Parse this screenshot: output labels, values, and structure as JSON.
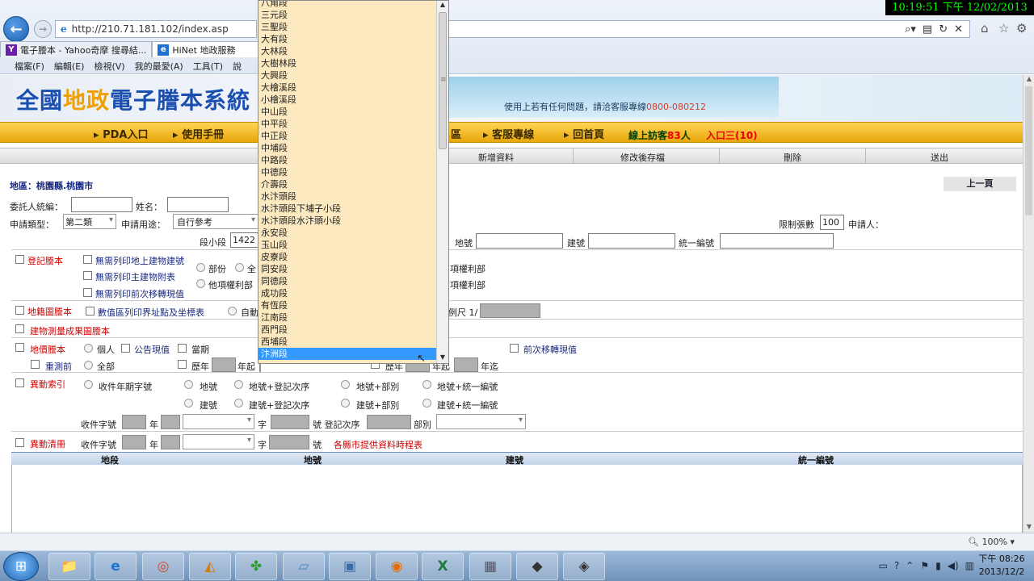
{
  "clock": "10:19:51 下午 12/02/2013",
  "browser": {
    "url_left": "http://210.71.181.102/index.asp",
    "addr_icons": [
      "search-icon",
      "compat-icon",
      "refresh-icon",
      "stop-icon"
    ],
    "tabs": [
      {
        "label": "電子謄本 - Yahoo奇摩 搜尋結...",
        "icon": "yahoo-icon",
        "color": "#6b1fa8"
      },
      {
        "label": "HiNet 地政服務",
        "icon": "ie-icon",
        "color": "#1e73d2"
      }
    ],
    "menu": [
      "檔案(F)",
      "編輯(E)",
      "檢視(V)",
      "我的最愛(A)",
      "工具(T)",
      "說"
    ]
  },
  "site": {
    "title_pre": "全國",
    "title_hl": "地政",
    "title_post": "電子謄本系統",
    "hotline_text": "使用上若有任何問題，請洽客服專線",
    "hotline_number": "0800-080212",
    "nav": [
      "PDA入口",
      "使用手冊",
      "區",
      "客服專線",
      "回首頁"
    ],
    "visitors_label": "線上訪客",
    "visitors_count": "83",
    "visitors_unit": "人",
    "entry": "入口三(10)"
  },
  "actions": [
    "新增資料",
    "修改後存檔",
    "刪除",
    "送出"
  ],
  "prev_page": "上一頁",
  "form": {
    "region_label": "地區：桃園縣.桃園市",
    "client_id_label": "委託人統編：",
    "name_label": "姓名：",
    "apply_type_label": "申請類型：",
    "apply_type_value": "第二類",
    "purpose_label": "申請用途：",
    "purpose_value": "自行參考",
    "limit_label": "限制張數",
    "limit_value": "100",
    "applicant_label": "申請人：",
    "section_label": "段小段",
    "section_value": "1422",
    "landno_label": "地號",
    "buildno_label": "建號",
    "uid_label": "統一編號"
  },
  "sections": {
    "register": {
      "title": "登記謄本",
      "opt1": "無需列印地上建物建號",
      "opt2": "無需列印主建物附表",
      "opt3": "無需列印前次移轉現值",
      "radio1": "部份",
      "radio2": "全",
      "radio3": "他項權利部",
      "right1": "項權利部",
      "right2": "項權利部"
    },
    "cadastral": {
      "title": "地籍圖謄本",
      "opt": "數值區列印界址點及坐標表",
      "radio": "自動",
      "scale": "例尺 1/"
    },
    "survey": {
      "title": "建物測量成果圖謄本"
    },
    "value": {
      "title": "地價謄本",
      "personal": "個人",
      "public": "公告現值",
      "current": "當期",
      "prev": "前次移轉現值",
      "remeasure": "重測前",
      "all": "全部",
      "year_from": "歷年",
      "year_start": "年起",
      "year_to": "年迄",
      "year_from2": "歷年",
      "year_start2": "年起",
      "year_to2": "年迄"
    },
    "change_index": {
      "title": "異動索引",
      "radio0": "收件年期字號",
      "r1": "地號",
      "r2": "地號+登記次序",
      "r3": "地號+部別",
      "r4": "地號+統一編號",
      "r5": "建號",
      "r6": "建號+登記次序",
      "r7": "建號+部別",
      "r8": "建號+統一編號",
      "recv_label": "收件字號",
      "year": "年",
      "zi": "字",
      "hao_label": "號 登記次序",
      "part_label": "部別"
    },
    "change_list": {
      "title": "異動清冊",
      "recv_label": "收件字號",
      "year": "年",
      "zi": "字",
      "hao": "號",
      "link": "各縣市提供資料時程表"
    }
  },
  "results_headers": [
    "地段",
    "地號",
    "建號",
    "統一編號"
  ],
  "dropdown": {
    "items": [
      "八角段",
      "三元段",
      "三聖段",
      "大有段",
      "大林段",
      "大樹林段",
      "大興段",
      "大檜溪段",
      "小檜溪段",
      "中山段",
      "中平段",
      "中正段",
      "中埔段",
      "中路段",
      "中德段",
      "介壽段",
      "水汴頭段",
      "水汴頭段下埔子小段",
      "水汴頭段水汴頭小段",
      "永安段",
      "玉山段",
      "皮寮段",
      "同安段",
      "同德段",
      "成功段",
      "有恆段",
      "江南段",
      "西門段",
      "西埔段",
      "汴洲段"
    ],
    "selected_index": 29
  },
  "status": {
    "zoom": "100%"
  },
  "taskbar": {
    "apps": [
      "folder-icon",
      "ie-icon",
      "chrome-icon",
      "pizza-icon",
      "parrot-icon",
      "notepad-icon",
      "image-icon",
      "firefox-icon",
      "excel-icon",
      "calculator-icon",
      "wallet-icon",
      "card-icon"
    ],
    "time": "下午 08:26",
    "date": "2013/12/2"
  }
}
